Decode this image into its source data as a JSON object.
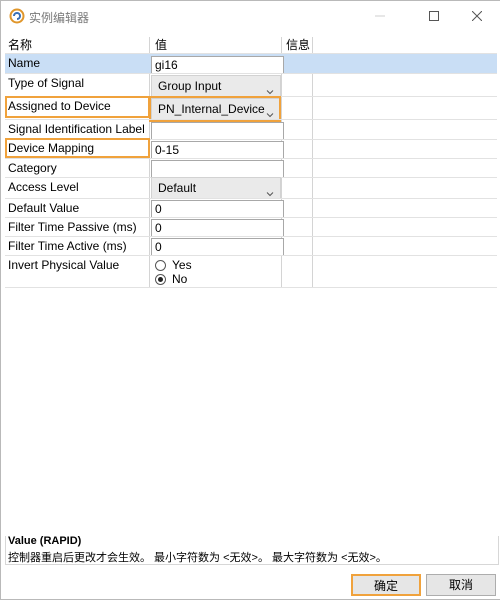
{
  "window": {
    "title": "实例编辑器"
  },
  "table": {
    "headers": {
      "name": "名称",
      "value": "值",
      "info": "信息"
    },
    "rows": [
      {
        "label": "Name",
        "value": "gi16"
      },
      {
        "label": "Type of Signal",
        "value": "Group Input"
      },
      {
        "label": "Assigned to Device",
        "value": "PN_Internal_Device"
      },
      {
        "label": "Signal Identification Label",
        "value": ""
      },
      {
        "label": "Device Mapping",
        "value": "0-15"
      },
      {
        "label": "Category",
        "value": ""
      },
      {
        "label": "Access Level",
        "value": "Default"
      },
      {
        "label": "Default Value",
        "value": "0"
      },
      {
        "label": "Filter Time Passive (ms)",
        "value": "0"
      },
      {
        "label": "Filter Time Active (ms)",
        "value": "0"
      },
      {
        "label": "Invert Physical Value",
        "options": [
          "Yes",
          "No"
        ],
        "selected": "No"
      }
    ]
  },
  "description": {
    "title": "Value (RAPID)",
    "text": "控制器重启后更改才会生效。 最小字符数为 <无效>。 最大字符数为 <无效>。"
  },
  "buttons": {
    "ok": "确定",
    "cancel": "取消"
  },
  "colors": {
    "highlight": "#f0a23c",
    "selected_row": "#c9def5",
    "button_bg": "#e6e6e6"
  }
}
